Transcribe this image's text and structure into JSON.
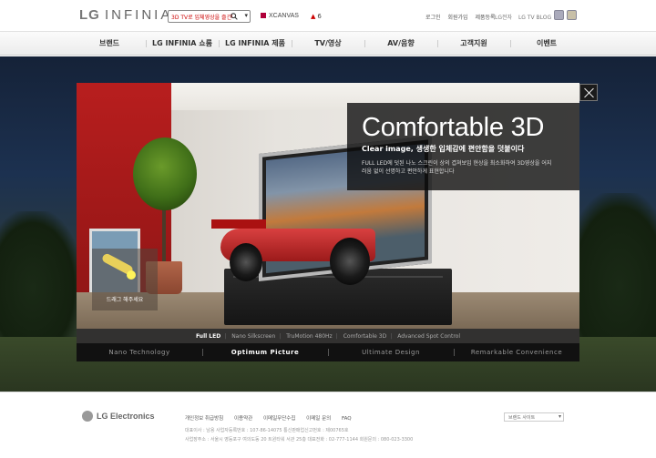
{
  "header": {
    "logo_main": "LG",
    "logo_sub": "INFINIA",
    "search_value": "3D TV로 입체영상을 즐긴다",
    "xcanvas": "XCANVAS",
    "rank_value": "6",
    "utility_links": [
      "로그인",
      "회원가입",
      "제품등록"
    ],
    "site_links": [
      "LG전자",
      "LG TV BLOG"
    ]
  },
  "nav": {
    "items": [
      "브랜드",
      "LG INFINIA 쇼룸",
      "LG INFINIA 제품",
      "TV/영상",
      "AV/음향",
      "고객지원",
      "이벤트"
    ]
  },
  "popup": {
    "title": "Comfortable 3D",
    "subtitle": "Clear image, 생생한 입체감에 편안함을 덧붙이다",
    "description": "FULL LED에 덧된 나노 스크린이 상의 겹쳐보임 현상을 최소화하여 3D영상을 어지러움 없이 선명하고 편안하게 표현합니다",
    "drag_hint": "드래그 해주세요",
    "features": [
      "Full LED",
      "Nano Silkscreen",
      "TruMotion 480Hz",
      "Comfortable 3D",
      "Advanced Spot Control"
    ],
    "tabs": [
      "Nano Technology",
      "Optimum Picture",
      "Ultimate Design",
      "Remarkable Convenience"
    ]
  },
  "footer": {
    "brand": "LG Electronics",
    "links": [
      "개인정보 취급방침",
      "이용약관",
      "이메일무단수집",
      "이메일 문의",
      "FAQ"
    ],
    "info_line1": "대표이사 : 남용    사업자등록번호 : 107-86-14075    통신판매업신고번호 : 제00765호",
    "info_line2": "사업장주소 : 서울시 영등포구 여의도동 20 트윈타워 서관 25층    대표전화 : 02-777-1144    회원문의 : 080-023-3300",
    "family_site": "브랜드 사이트"
  },
  "colors": {
    "accent_red": "#b0003a",
    "popup_copy_bg": "#0a0a0a"
  }
}
